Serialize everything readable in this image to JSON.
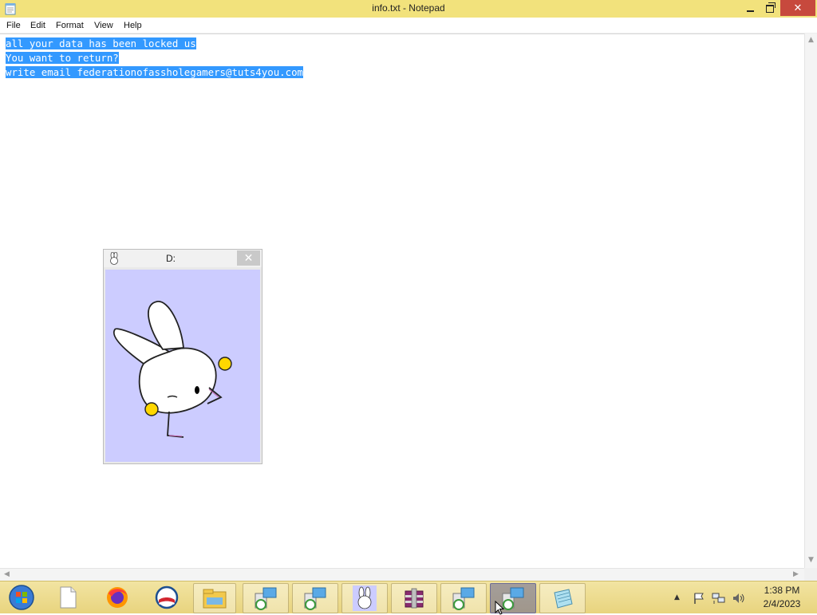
{
  "window": {
    "title": "info.txt - Notepad",
    "close_glyph": "✕"
  },
  "menu": {
    "items": [
      "File",
      "Edit",
      "Format",
      "View",
      "Help"
    ]
  },
  "editor": {
    "lines": [
      "all your data has been locked us",
      "You want to return?",
      "write email federationofassholegamers@tuts4you.com"
    ],
    "selection_color": "#3399ff"
  },
  "popup": {
    "title": "D:",
    "close_glyph": "✕",
    "background_color": "#ccccff"
  },
  "taskbar": {
    "items": [
      {
        "icon": "windows-start-orb-icon"
      },
      {
        "icon": "blank-document-icon"
      },
      {
        "icon": "firefox-icon"
      },
      {
        "icon": "obama-logo-icon"
      },
      {
        "icon": "file-explorer-icon"
      },
      {
        "icon": "setup-installer-icon"
      },
      {
        "icon": "setup-installer-icon"
      },
      {
        "icon": "bunny-icon"
      },
      {
        "icon": "winrar-icon"
      },
      {
        "icon": "setup-installer-icon"
      },
      {
        "icon": "setup-installer-icon",
        "active": true
      },
      {
        "icon": "notepad-icon"
      }
    ],
    "tray": {
      "show_hidden_glyph": "▲",
      "time": "1:38 PM",
      "date": "2/4/2023"
    }
  }
}
